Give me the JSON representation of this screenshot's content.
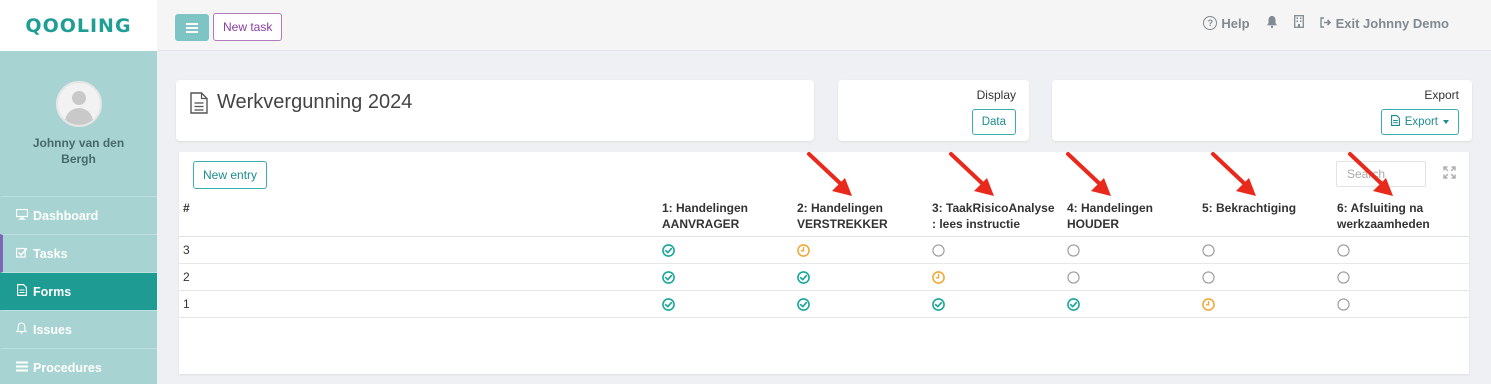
{
  "app": {
    "logo": "QOOLING"
  },
  "user": {
    "name": "Johnny van den Bergh"
  },
  "sidebar": {
    "items": [
      {
        "label": "Dashboard",
        "icon": "monitor-icon",
        "active": false
      },
      {
        "label": "Tasks",
        "icon": "checkbox-icon",
        "active": false
      },
      {
        "label": "Forms",
        "icon": "document-icon",
        "active": true
      },
      {
        "label": "Issues",
        "icon": "bell-icon",
        "active": false
      },
      {
        "label": "Procedures",
        "icon": "list-icon",
        "active": false
      }
    ]
  },
  "topbar": {
    "new_task": "New task",
    "help": "Help",
    "exit": "Exit Johnny Demo"
  },
  "page": {
    "title": "Werkvergunning 2024"
  },
  "display": {
    "label": "Display",
    "button": "Data"
  },
  "export": {
    "label": "Export",
    "button": "Export"
  },
  "table": {
    "new_entry": "New entry",
    "search_placeholder": "Search",
    "columns": [
      "#",
      "1: Handelingen AANVRAGER",
      "2: Handelingen VERSTREKKER",
      "3: TaakRisicoAnalyse : lees instructie",
      "4: Handelingen HOUDER",
      "5: Bekrachtiging",
      "6: Afsluiting na werkzaamheden"
    ],
    "rows": [
      {
        "id": "3",
        "statuses": [
          "done",
          "pending",
          "empty",
          "empty",
          "empty",
          "empty"
        ]
      },
      {
        "id": "2",
        "statuses": [
          "done",
          "done",
          "pending",
          "empty",
          "empty",
          "empty"
        ]
      },
      {
        "id": "1",
        "statuses": [
          "done",
          "done",
          "done",
          "done",
          "pending",
          "empty"
        ]
      }
    ]
  },
  "colors": {
    "accent": "#1e9c93",
    "sidebar": "#a7d3d2",
    "done": "#1aa79c",
    "pending": "#f2a93b",
    "empty": "#9a9a9a",
    "arrow": "#e8291c"
  }
}
